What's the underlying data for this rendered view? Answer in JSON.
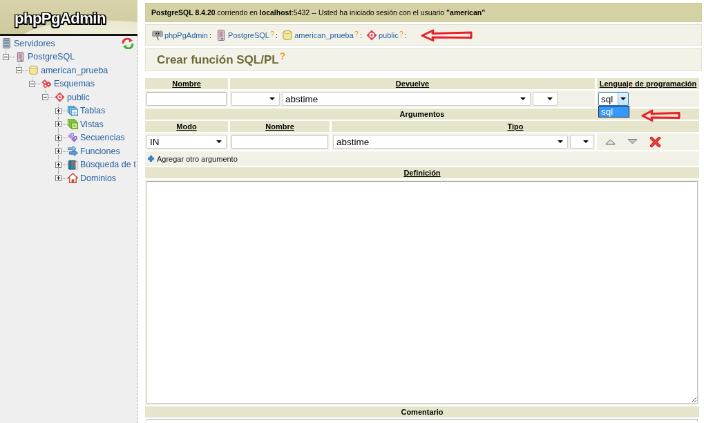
{
  "sidebar": {
    "logo": "phpPgAdmin",
    "tree": [
      {
        "label": "Servidores",
        "kind": "servers",
        "children": [
          {
            "label": "PostgreSQL",
            "kind": "server",
            "expanded": true,
            "children": [
              {
                "label": "american_prueba",
                "kind": "database",
                "expanded": true,
                "children": [
                  {
                    "label": "Esquemas",
                    "kind": "schemas",
                    "expanded": true,
                    "children": [
                      {
                        "label": "public",
                        "kind": "schema",
                        "expanded": true,
                        "children": [
                          {
                            "label": "Tablas",
                            "kind": "tables",
                            "expanded": false
                          },
                          {
                            "label": "Vistas",
                            "kind": "views",
                            "expanded": false
                          },
                          {
                            "label": "Secuencias",
                            "kind": "sequences",
                            "expanded": false
                          },
                          {
                            "label": "Funciones",
                            "kind": "functions",
                            "expanded": false
                          },
                          {
                            "label": "Búsqueda de t",
                            "kind": "fulltext",
                            "expanded": false
                          },
                          {
                            "label": "Dominios",
                            "kind": "domains",
                            "expanded": false
                          }
                        ]
                      }
                    ]
                  }
                ]
              }
            ]
          }
        ]
      }
    ]
  },
  "top_bar": {
    "text": "**PostgreSQL 8.4.20** corriendo en **localhost**:5432 -- Usted ha iniciado sesión con el usuario **\"american\"**"
  },
  "breadcrumb": [
    {
      "kind": "app",
      "label": "phpPgAdmin",
      "separator": ":"
    },
    {
      "kind": "server",
      "label": "PostgreSQL",
      "help": "?",
      "separator": ":"
    },
    {
      "kind": "database",
      "label": "american_prueba",
      "help": "?",
      "separator": ":"
    },
    {
      "kind": "schema",
      "label": "public",
      "help": "?",
      "separator": ":"
    }
  ],
  "title": {
    "text": "Crear función SQL/PL",
    "help": "?"
  },
  "form": {
    "columns": [
      {
        "label": "Nombre",
        "kind": "link"
      },
      {
        "label": "Devuelve",
        "kind": "link"
      },
      {
        "label": "Lenguaje de programación",
        "kind": "link"
      }
    ],
    "return_type": "abstime",
    "language": {
      "value": "sql",
      "open": true,
      "options": [
        {
          "label": "sql",
          "selected": true
        }
      ]
    },
    "arguments": {
      "title": {
        "label": "Argumentos",
        "kind": "text"
      },
      "columns": [
        {
          "label": "Modo",
          "kind": "link"
        },
        {
          "label": "Nombre",
          "kind": "link"
        },
        {
          "label": "Tipo",
          "kind": "link"
        }
      ],
      "rows": [
        {
          "mode": "IN",
          "type": "abstime"
        }
      ],
      "add_link": "Agregar otro argumento"
    },
    "definition": {
      "label": "Definición",
      "kind": "link"
    },
    "comment": {
      "label": "Comentario",
      "kind": "text"
    }
  }
}
